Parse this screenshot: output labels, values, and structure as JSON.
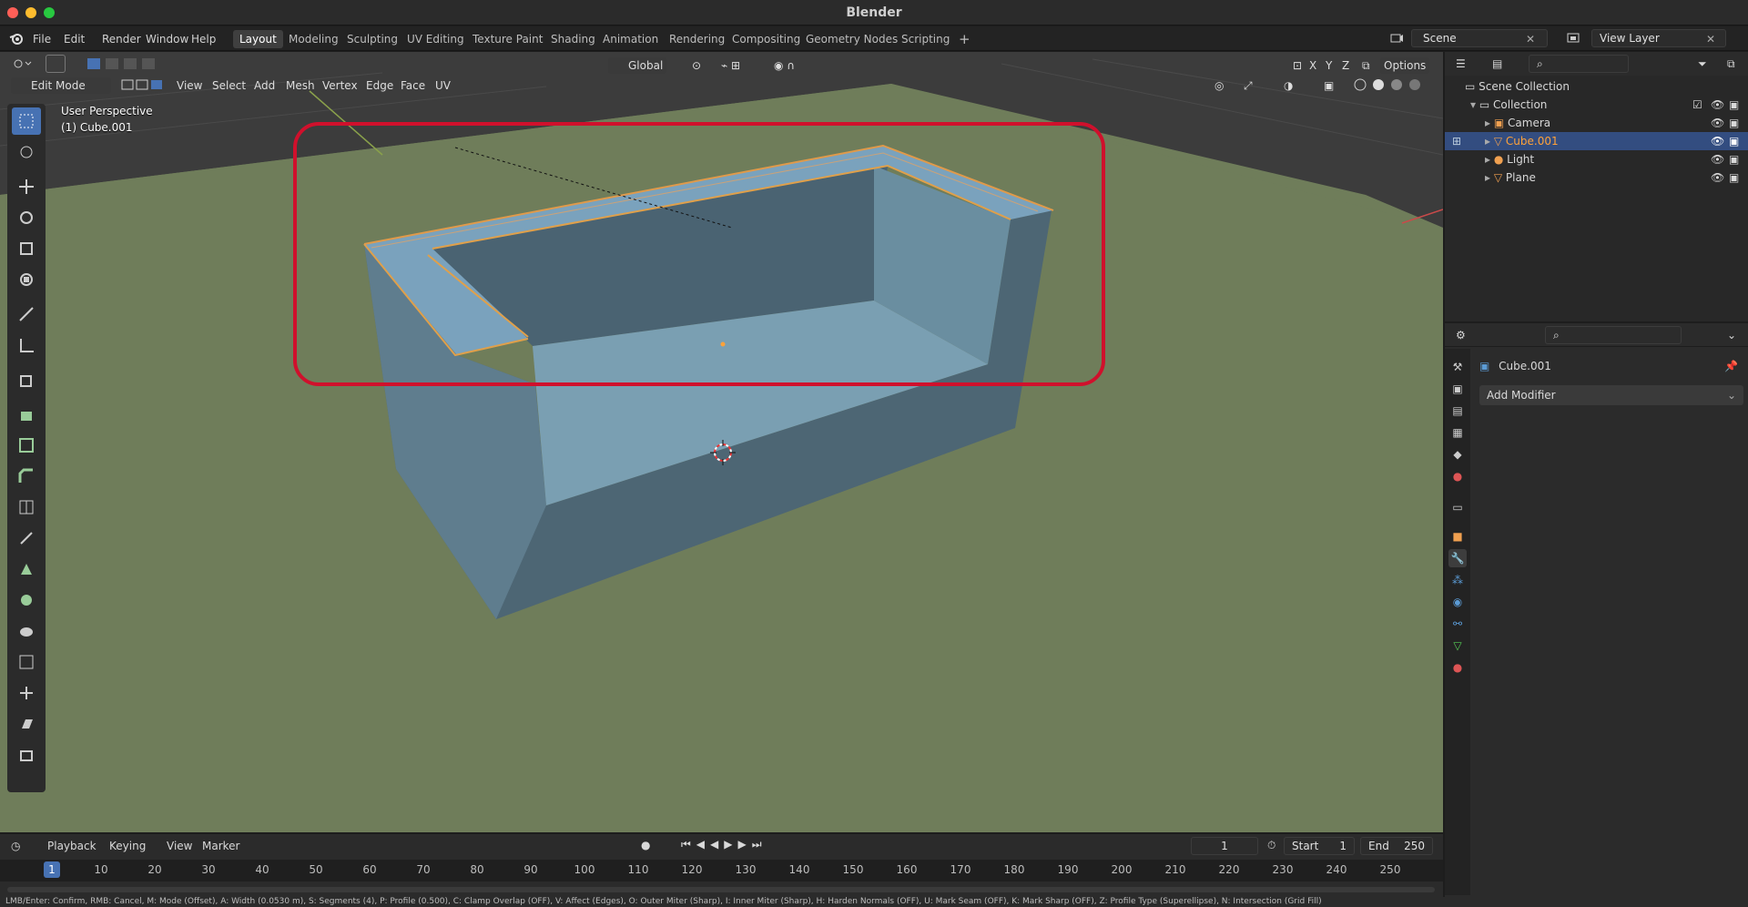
{
  "window": {
    "title": "Blender"
  },
  "menu": {
    "file": "File",
    "edit": "Edit",
    "render": "Render",
    "window": "Window",
    "help": "Help"
  },
  "workspaces": [
    "Layout",
    "Modeling",
    "Sculpting",
    "UV Editing",
    "Texture Paint",
    "Shading",
    "Animation",
    "Rendering",
    "Compositing",
    "Geometry Nodes",
    "Scripting"
  ],
  "active_workspace": "Layout",
  "scene": {
    "name": "Scene",
    "view_layer": "View Layer"
  },
  "header": {
    "mode": "Edit Mode",
    "view": "View",
    "select": "Select",
    "add": "Add",
    "mesh": "Mesh",
    "vertex": "Vertex",
    "edge": "Edge",
    "face": "Face",
    "uv": "UV",
    "orientation": "Global",
    "options": "Options",
    "axes": [
      "X",
      "Y",
      "Z"
    ]
  },
  "viewport": {
    "perspective": "User Perspective",
    "object": "(1) Cube.001"
  },
  "outliner": {
    "root": "Scene Collection",
    "collection": "Collection",
    "items": [
      {
        "name": "Camera",
        "selected": false
      },
      {
        "name": "Cube.001",
        "selected": true
      },
      {
        "name": "Light",
        "selected": false
      },
      {
        "name": "Plane",
        "selected": false
      }
    ]
  },
  "properties": {
    "object_name": "Cube.001",
    "add_modifier": "Add Modifier"
  },
  "timeline": {
    "playback": "Playback",
    "keying": "Keying",
    "view": "View",
    "marker": "Marker",
    "current_frame": "1",
    "start_label": "Start",
    "start": "1",
    "end_label": "End",
    "end": "250",
    "ticks": [
      "1",
      "10",
      "20",
      "30",
      "40",
      "50",
      "60",
      "70",
      "80",
      "90",
      "100",
      "110",
      "120",
      "130",
      "140",
      "150",
      "160",
      "170",
      "180",
      "190",
      "200",
      "210",
      "220",
      "230",
      "240",
      "250"
    ]
  },
  "status": {
    "text": "LMB/Enter: Confirm, RMB: Cancel, M: Mode (Offset), A: Width (0.0530 m), S: Segments (4), P: Profile (0.500), C: Clamp Overlap (OFF), V: Affect (Edges), O: Outer Miter (Sharp), I: Inner Miter (Sharp), H: Harden Normals (OFF), U: Mark Seam (OFF), K: Mark Sharp (OFF), Z: Profile Type (Superellipse), N: Intersection (Grid Fill)"
  },
  "colors": {
    "accent": "#4772b3",
    "highlight": "#d0102c",
    "orange": "#ffa239"
  }
}
